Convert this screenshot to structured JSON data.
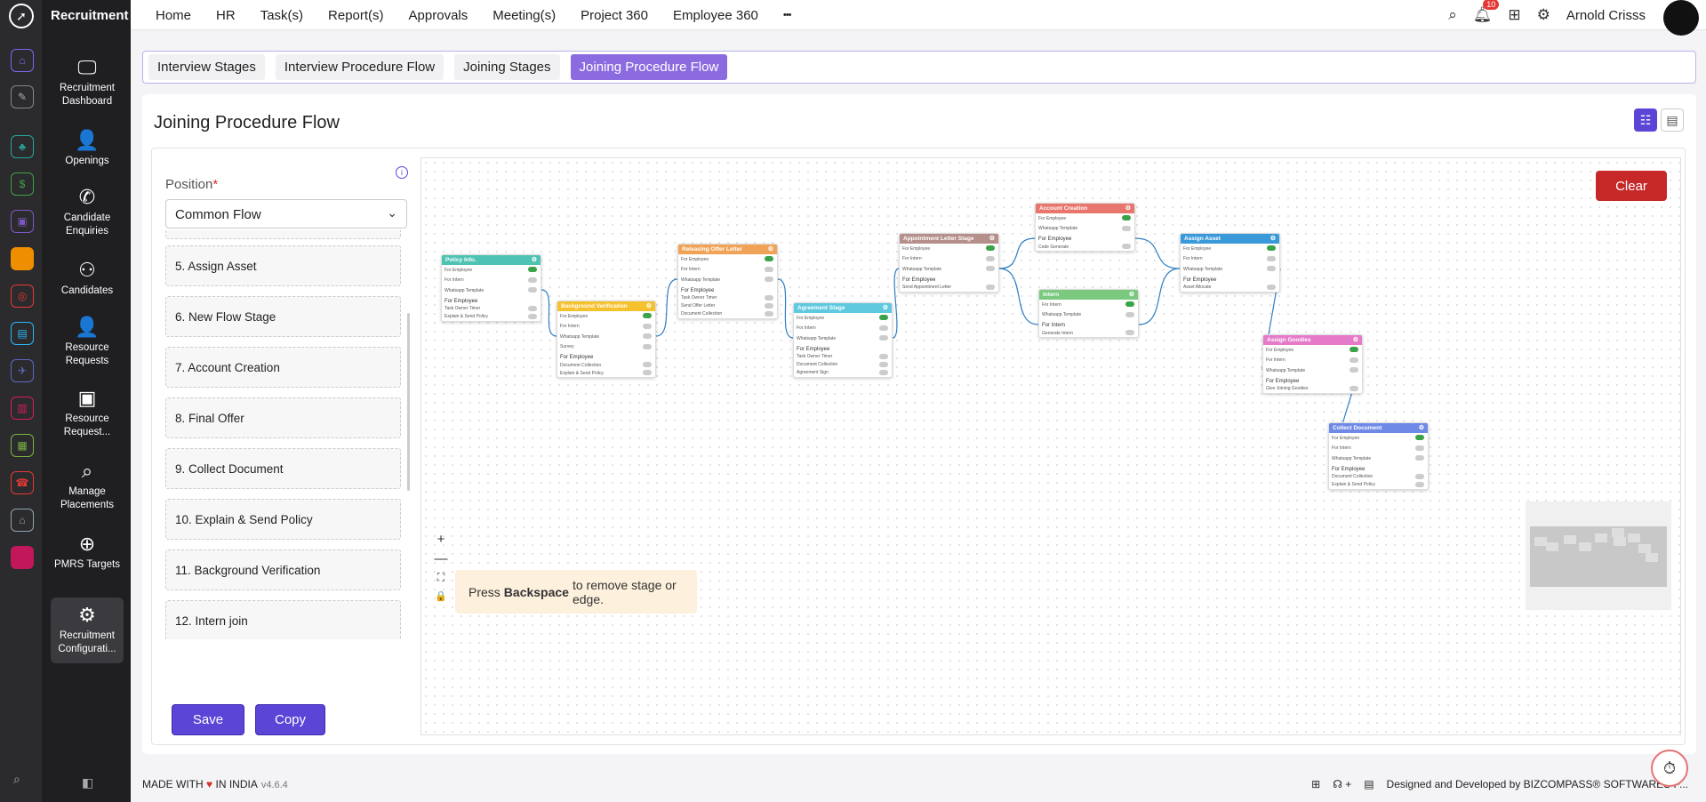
{
  "app": {
    "name": "Recruitment"
  },
  "top_nav": [
    "Home",
    "HR",
    "Task(s)",
    "Report(s)",
    "Approvals",
    "Meeting(s)",
    "Project 360",
    "Employee 360"
  ],
  "more_icon": "•••",
  "user": {
    "name": "Arnold Crisss",
    "notifications": "10"
  },
  "menu": [
    {
      "label": "Recruitment Dashboard",
      "icon": "monitor-icon"
    },
    {
      "label": "Openings",
      "icon": "user-icon"
    },
    {
      "label": "Candidate Enquiries",
      "icon": "phone-icon"
    },
    {
      "label": "Candidates",
      "icon": "people-icon"
    },
    {
      "label": "Resource Requests",
      "icon": "user-doc-icon"
    },
    {
      "label": "Resource Request...",
      "icon": "user-card-icon"
    },
    {
      "label": "Manage Placements",
      "icon": "search-icon"
    },
    {
      "label": "PMRS Targets",
      "icon": "target-icon"
    },
    {
      "label": "Recruitment Configurati...",
      "icon": "gear-icon"
    }
  ],
  "tabs": [
    "Interview Stages",
    "Interview Procedure Flow",
    "Joining Stages",
    "Joining Procedure Flow"
  ],
  "active_tab": 3,
  "page_title": "Joining Procedure Flow",
  "position": {
    "label": "Position",
    "required": "*",
    "value": "Common Flow"
  },
  "stages": [
    "5. Assign Asset",
    "6. New Flow Stage",
    "7. Account Creation",
    "8. Final Offer",
    "9. Collect Document",
    "10. Explain & Send Policy",
    "11. Background Verification",
    "12. Intern join"
  ],
  "buttons": {
    "save": "Save",
    "copy": "Copy",
    "clear": "Clear"
  },
  "hint": {
    "pre": "Press",
    "key": "Backspace",
    "post": "to remove stage or edge."
  },
  "zoom": [
    "+",
    "—",
    "⛶",
    "🔒"
  ],
  "nodes": [
    {
      "title": "Policy Info.",
      "color": "#4fc3b3",
      "rows": [
        "For Employee",
        "For Intern",
        "Whatsapp Template"
      ],
      "hd": "For Employee",
      "sub": [
        "Task Owner Timer",
        "Explain & Send Policy"
      ]
    },
    {
      "title": "Background Verification",
      "color": "#f5c22e",
      "rows": [
        "For Employee",
        "For Intern",
        "Whatsapp Template",
        "Survey"
      ],
      "hd": "For Employee",
      "sub": [
        "Document Collection",
        "Explain & Send Policy"
      ]
    },
    {
      "title": "Releasing Offer Letter",
      "color": "#f0a356",
      "rows": [
        "For Employee",
        "For Intern",
        "Whatsapp Template"
      ],
      "hd": "For Employee",
      "sub": [
        "Task Owner Timer",
        "Send Offer Letter",
        "Document Collection"
      ]
    },
    {
      "title": "Agreement Stage",
      "color": "#5fc9e0",
      "rows": [
        "For Employee",
        "For Intern",
        "Whatsapp Template"
      ],
      "hd": "For Employee",
      "sub": [
        "Task Owner Timer",
        "Document Collection",
        "Agreement Sign"
      ]
    },
    {
      "title": "Appointment Letter Stage",
      "color": "#b5908a",
      "rows": [
        "For Employee",
        "For Intern",
        "Whatsapp Template"
      ],
      "hd": "For Employee",
      "sub": [
        "Send Appointment Letter"
      ]
    },
    {
      "title": "Account Creation",
      "color": "#e8766d",
      "rows": [
        "For Employee",
        "Whatsapp Template"
      ],
      "hd": "For Employee",
      "sub": [
        "Code Generate"
      ]
    },
    {
      "title": "Intern",
      "color": "#7bc97f",
      "rows": [
        "For Intern",
        "Whatsapp Template"
      ],
      "hd": "For Intern",
      "sub": [
        "Generate Intern"
      ]
    },
    {
      "title": "Assign Asset",
      "color": "#3a9ad9",
      "rows": [
        "For Employee",
        "For Intern",
        "Whatsapp Template"
      ],
      "hd": "For Employee",
      "sub": [
        "Asset Allocate"
      ]
    },
    {
      "title": "Assign Goodies",
      "color": "#e57ac9",
      "rows": [
        "For Employee",
        "For Intern",
        "Whatsapp Template"
      ],
      "hd": "For Employee",
      "sub": [
        "Give Joining Goodies"
      ]
    },
    {
      "title": "Collect Document",
      "color": "#6f8ae6",
      "rows": [
        "For Employee",
        "For Intern",
        "Whatsapp Template"
      ],
      "hd": "For Employee",
      "sub": [
        "Document Collection",
        "Explain & Send Policy"
      ]
    }
  ],
  "footer": {
    "made": "MADE WITH",
    "in": "IN INDIA",
    "version": "v4.6.4",
    "designed": "Designed and Developed by",
    "company": "BIZCOMPASS® SOFTWARES P..."
  }
}
